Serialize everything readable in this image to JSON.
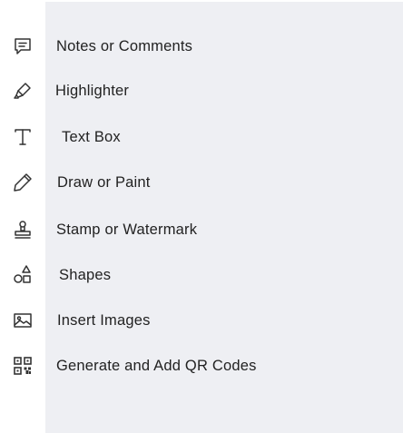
{
  "tools": [
    {
      "label": "Notes or Comments",
      "icon": "comment-icon"
    },
    {
      "label": "Highlighter",
      "icon": "highlighter-icon"
    },
    {
      "label": "Text Box",
      "icon": "text-icon"
    },
    {
      "label": "Draw or Paint",
      "icon": "pencil-icon"
    },
    {
      "label": "Stamp or Watermark",
      "icon": "stamp-icon"
    },
    {
      "label": "Shapes",
      "icon": "shapes-icon"
    },
    {
      "label": "Insert Images",
      "icon": "image-icon"
    },
    {
      "label": "Generate and Add QR Codes",
      "icon": "qr-code-icon"
    }
  ],
  "colors": {
    "panel_background": "#eeeff3",
    "sidebar_background": "#ffffff",
    "text": "#222222",
    "icon": "#333333"
  }
}
